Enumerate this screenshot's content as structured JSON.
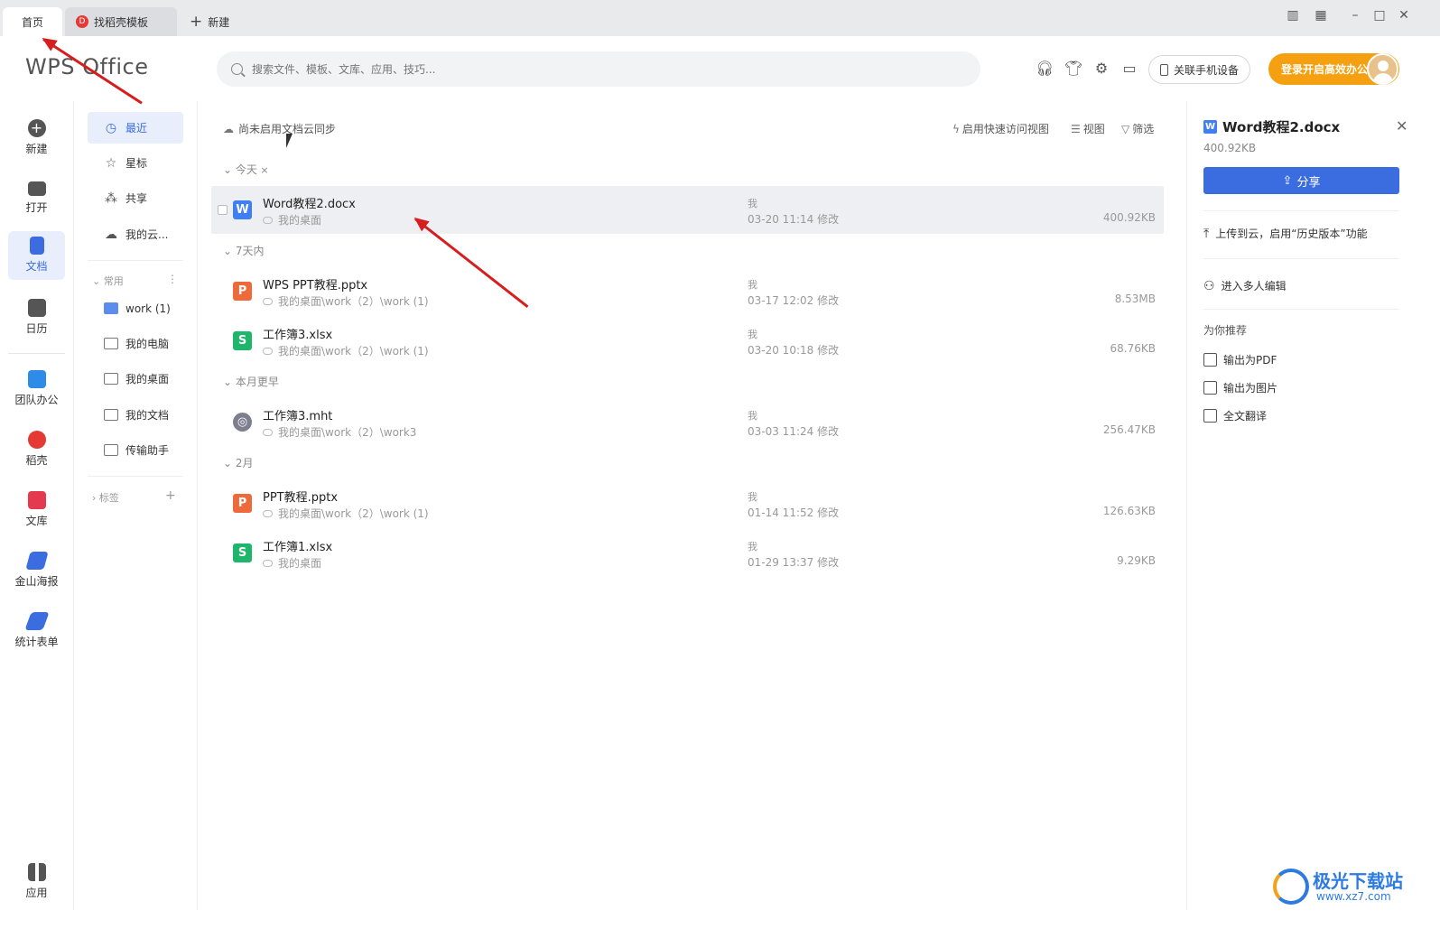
{
  "tabs": [
    {
      "label": "首页",
      "active": true
    },
    {
      "label": "找稻壳模板",
      "logo": "D"
    },
    {
      "label": "新建"
    }
  ],
  "window_controls": [
    "layout-icon",
    "grid-icon",
    "minimize-icon",
    "maximize-icon",
    "close-icon"
  ],
  "brand": "WPS Office",
  "search": {
    "placeholder": "搜索文件、模板、文库、应用、技巧..."
  },
  "header": {
    "icons": [
      "headset-icon",
      "shirt-icon",
      "gear-icon",
      "chat-icon"
    ],
    "link_phone": "关联手机设备",
    "login": "登录开启高效办公"
  },
  "rail": [
    {
      "label": "新建",
      "icon": "plus-circle-icon",
      "color": "#555555"
    },
    {
      "label": "打开",
      "icon": "folder-icon",
      "color": "#555555"
    },
    {
      "label": "文档",
      "icon": "document-icon",
      "color": "#3b6de0",
      "active": true
    },
    {
      "label": "日历",
      "icon": "calendar-icon",
      "color": "#555555"
    },
    {
      "label": "团队办公",
      "icon": "team-icon",
      "color": "#2e8be8"
    },
    {
      "label": "稻壳",
      "icon": "daoke-icon",
      "color": "#e53935"
    },
    {
      "label": "文库",
      "icon": "library-icon",
      "color": "#e53950"
    },
    {
      "label": "金山海报",
      "icon": "poster-icon",
      "color": "#3b6de0"
    },
    {
      "label": "统计表单",
      "icon": "form-icon",
      "color": "#3b6de0"
    },
    {
      "label": "应用",
      "icon": "apps-icon",
      "color": "#555555"
    }
  ],
  "nav": {
    "items": [
      {
        "label": "最近",
        "icon": "clock-icon",
        "active": true
      },
      {
        "label": "星标",
        "icon": "star-icon"
      },
      {
        "label": "共享",
        "icon": "share-nodes-icon"
      },
      {
        "label": "我的云...",
        "icon": "cloud-icon"
      }
    ],
    "common_label": "常用",
    "common": [
      {
        "label": "work (1)",
        "icon": "folder-blue-icon"
      },
      {
        "label": "我的电脑",
        "icon": "computer-folder-icon"
      },
      {
        "label": "我的桌面",
        "icon": "desktop-folder-icon"
      },
      {
        "label": "我的文档",
        "icon": "documents-folder-icon"
      },
      {
        "label": "传输助手",
        "icon": "transfer-folder-icon"
      }
    ],
    "tags_label": "标签"
  },
  "toolbar": {
    "cloud_sync": "尚未启用文档云同步",
    "quick_access": "启用快速访问视图",
    "view": "视图",
    "filter": "筛选"
  },
  "groups": [
    {
      "label": "今天",
      "files": [
        {
          "name": "Word教程2.docx",
          "type": "w",
          "path": "我的桌面",
          "owner": "我",
          "time": "03-20 11:14 修改",
          "size": "400.92KB",
          "selected": true
        }
      ]
    },
    {
      "label": "7天内",
      "files": [
        {
          "name": "WPS PPT教程.pptx",
          "type": "p",
          "path": "我的桌面\\work（2）\\work (1)",
          "owner": "我",
          "time": "03-17 12:02 修改",
          "size": "8.53MB"
        },
        {
          "name": "工作簿3.xlsx",
          "type": "s",
          "path": "我的桌面\\work（2）\\work (1)",
          "owner": "我",
          "time": "03-20 10:18 修改",
          "size": "68.76KB"
        }
      ]
    },
    {
      "label": "本月更早",
      "files": [
        {
          "name": "工作簿3.mht",
          "type": "m",
          "path": "我的桌面\\work（2）\\work3",
          "owner": "我",
          "time": "03-03 11:24 修改",
          "size": "256.47KB"
        }
      ]
    },
    {
      "label": "2月",
      "files": [
        {
          "name": "PPT教程.pptx",
          "type": "p",
          "path": "我的桌面\\work（2）\\work (1)",
          "owner": "我",
          "time": "01-14 11:52 修改",
          "size": "126.63KB"
        },
        {
          "name": "工作簿1.xlsx",
          "type": "s",
          "path": "我的桌面",
          "owner": "我",
          "time": "01-29 13:37 修改",
          "size": "9.29KB"
        }
      ]
    }
  ],
  "file_icon_glyphs": {
    "w": "W",
    "p": "P",
    "s": "S",
    "m": "◎"
  },
  "panel": {
    "title": "Word教程2.docx",
    "size": "400.92KB",
    "share": "分享",
    "upload": "上传到云，启用“历史版本”功能",
    "collab": "进入多人编辑",
    "recommend": "为你推荐",
    "actions": [
      {
        "label": "输出为PDF",
        "icon": "pdf-export-icon"
      },
      {
        "label": "输出为图片",
        "icon": "image-export-icon"
      },
      {
        "label": "全文翻译",
        "icon": "translate-icon"
      }
    ]
  },
  "watermark": {
    "title": "极光下载站",
    "url": "www.xz7.com"
  }
}
